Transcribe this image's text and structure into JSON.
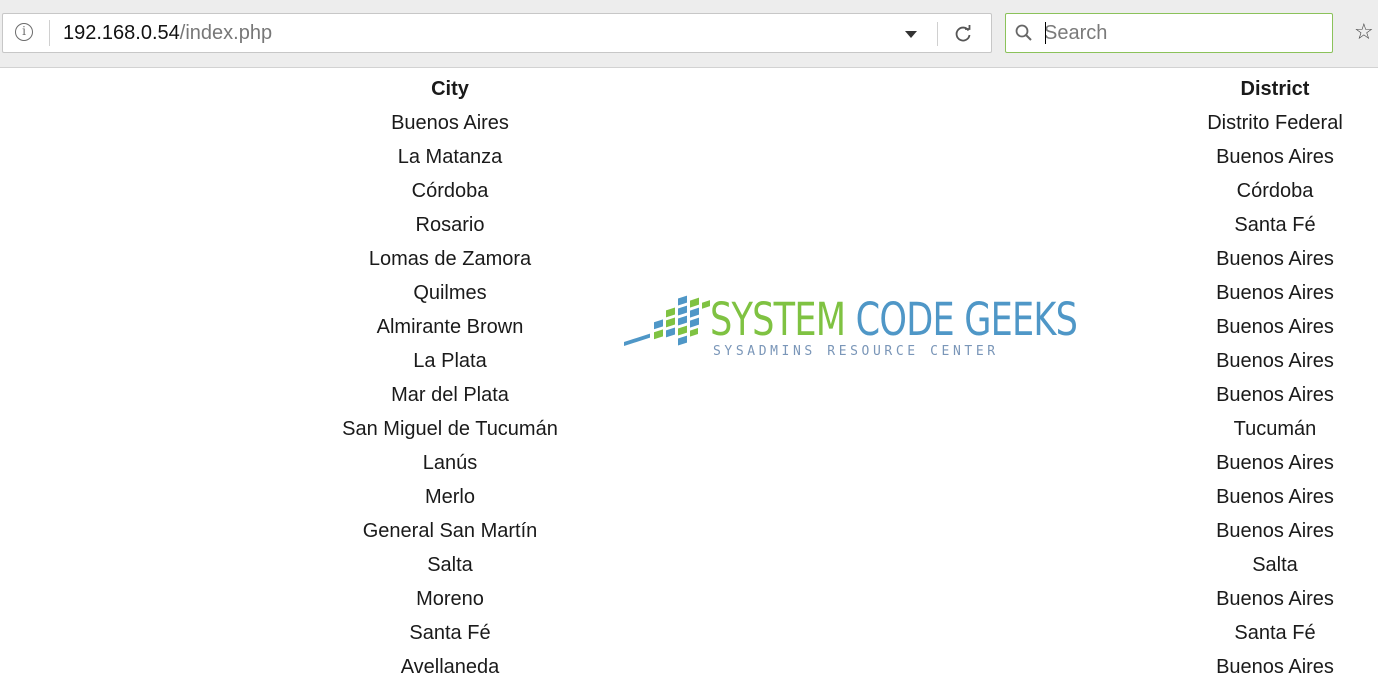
{
  "browser": {
    "url_host": "192.168.0.54",
    "url_path": "/index.php",
    "search_placeholder": "Search",
    "icons": {
      "info": "info-icon",
      "dropdown": "dropdown-arrow-icon",
      "reload": "reload-icon",
      "search": "search-icon",
      "bookmark": "bookmark-star-icon"
    },
    "search_focus_color": "#8bc25a"
  },
  "table": {
    "headers": {
      "city": "City",
      "district": "District"
    },
    "rows": [
      {
        "city": "Buenos Aires",
        "district": "Distrito Federal"
      },
      {
        "city": "La Matanza",
        "district": "Buenos Aires"
      },
      {
        "city": "Córdoba",
        "district": "Córdoba"
      },
      {
        "city": "Rosario",
        "district": "Santa Fé"
      },
      {
        "city": "Lomas de Zamora",
        "district": "Buenos Aires"
      },
      {
        "city": "Quilmes",
        "district": "Buenos Aires"
      },
      {
        "city": "Almirante Brown",
        "district": "Buenos Aires"
      },
      {
        "city": "La Plata",
        "district": "Buenos Aires"
      },
      {
        "city": "Mar del Plata",
        "district": "Buenos Aires"
      },
      {
        "city": "San Miguel de Tucumán",
        "district": "Tucumán"
      },
      {
        "city": "Lanús",
        "district": "Buenos Aires"
      },
      {
        "city": "Merlo",
        "district": "Buenos Aires"
      },
      {
        "city": "General San Martín",
        "district": "Buenos Aires"
      },
      {
        "city": "Salta",
        "district": "Salta"
      },
      {
        "city": "Moreno",
        "district": "Buenos Aires"
      },
      {
        "city": "Santa Fé",
        "district": "Santa Fé"
      },
      {
        "city": "Avellaneda",
        "district": "Buenos Aires"
      }
    ]
  },
  "watermark": {
    "title_part1": "SYSTEM",
    "title_part2": "CODE GEEKS",
    "subtitle": "SYSADMINS RESOURCE CENTER",
    "colors": {
      "green": "#7fc242",
      "blue": "#4f97c7"
    }
  }
}
